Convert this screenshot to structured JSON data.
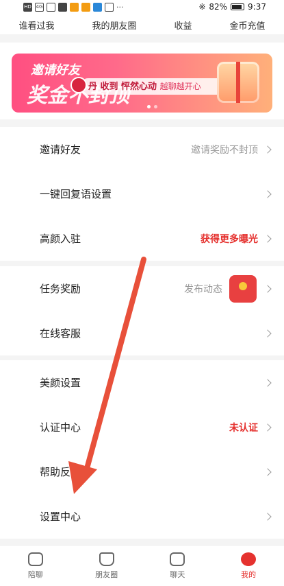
{
  "status_bar": {
    "left_icons": [
      "HD",
      "4G",
      "wifi",
      "shield",
      "app1",
      "app2",
      "app3",
      "app4"
    ],
    "left_more": "···",
    "battery": "82%",
    "time": "9:37"
  },
  "top_nav": {
    "items": [
      "谁看过我",
      "我的朋友圈",
      "收益",
      "金币充值"
    ]
  },
  "banner": {
    "title": "邀请好友",
    "big": "奖金不封顶",
    "pill_main": "丹 收到 怦然心动",
    "pill_sub": "越聊越开心"
  },
  "section1": [
    {
      "label": "邀请好友",
      "value": "邀请奖励不封顶"
    },
    {
      "label": "一键回复语设置",
      "value": ""
    },
    {
      "label": "高颜入驻",
      "value": "获得更多曝光"
    }
  ],
  "section2": [
    {
      "label": "任务奖励",
      "value": "发布动态"
    },
    {
      "label": "在线客服",
      "value": ""
    }
  ],
  "section3": [
    {
      "label": "美颜设置",
      "value": ""
    },
    {
      "label": "认证中心",
      "value": "未认证"
    },
    {
      "label": "帮助反馈",
      "value": ""
    },
    {
      "label": "设置中心",
      "value": ""
    }
  ],
  "tab_bar": {
    "tabs": [
      "陪聊",
      "朋友圈",
      "聊天",
      "我的"
    ]
  },
  "colors": {
    "accent": "#e5322f",
    "arrow": "#e8503a"
  }
}
